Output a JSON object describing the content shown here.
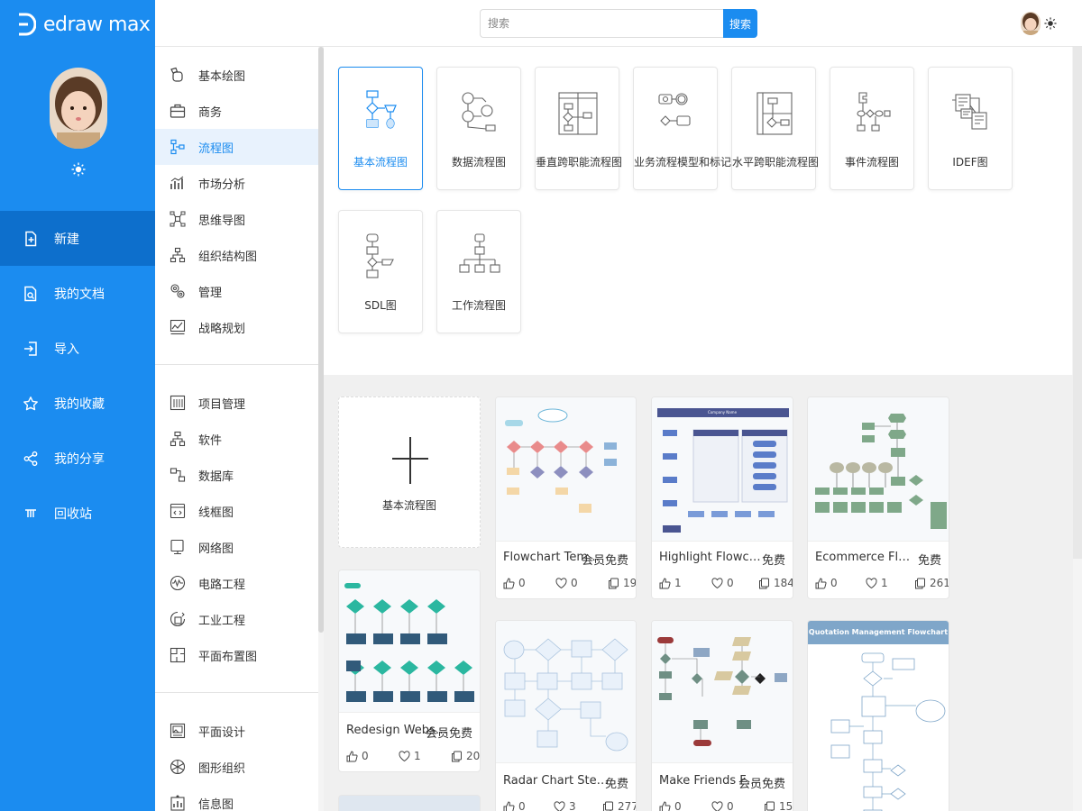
{
  "app": {
    "brand": "edraw max"
  },
  "search": {
    "placeholder": "搜索",
    "button": "搜索"
  },
  "leftnav": [
    {
      "label": "新建",
      "icon": "new-file-icon",
      "active": true
    },
    {
      "label": "我的文档",
      "icon": "documents-icon"
    },
    {
      "label": "导入",
      "icon": "import-icon"
    },
    {
      "label": "我的收藏",
      "icon": "star-icon"
    },
    {
      "label": "我的分享",
      "icon": "share-icon"
    },
    {
      "label": "回收站",
      "icon": "trash-icon"
    }
  ],
  "categories": {
    "group1": [
      {
        "label": "基本绘图",
        "icon": "basic-shapes-icon"
      },
      {
        "label": "商务",
        "icon": "briefcase-icon"
      },
      {
        "label": "流程图",
        "icon": "flowchart-icon",
        "active": true
      },
      {
        "label": "市场分析",
        "icon": "bar-chart-icon"
      },
      {
        "label": "思维导图",
        "icon": "mindmap-icon"
      },
      {
        "label": "组织结构图",
        "icon": "org-chart-icon"
      },
      {
        "label": "管理",
        "icon": "management-icon"
      },
      {
        "label": "战略规划",
        "icon": "strategy-chart-icon"
      }
    ],
    "group2": [
      {
        "label": "项目管理",
        "icon": "project-icon"
      },
      {
        "label": "软件",
        "icon": "software-icon"
      },
      {
        "label": "数据库",
        "icon": "database-icon"
      },
      {
        "label": "线框图",
        "icon": "wireframe-icon"
      },
      {
        "label": "网络图",
        "icon": "network-icon"
      },
      {
        "label": "电路工程",
        "icon": "circuit-icon"
      },
      {
        "label": "工业工程",
        "icon": "industrial-icon"
      },
      {
        "label": "平面布置图",
        "icon": "floorplan-icon"
      }
    ],
    "group3": [
      {
        "label": "平面设计",
        "icon": "graphic-design-icon"
      },
      {
        "label": "图形组织",
        "icon": "graphic-organizer-icon"
      },
      {
        "label": "信息图",
        "icon": "infographic-icon"
      }
    ]
  },
  "types": [
    {
      "label": "基本流程图",
      "active": true
    },
    {
      "label": "数据流程图"
    },
    {
      "label": "垂直跨职能流程图"
    },
    {
      "label": "业务流程模型和标记法"
    },
    {
      "label": "水平跨职能流程图"
    },
    {
      "label": "事件流程图"
    },
    {
      "label": "IDEF图"
    },
    {
      "label": "SDL图"
    },
    {
      "label": "工作流程图"
    }
  ],
  "new_card": {
    "label": "基本流程图"
  },
  "templates": [
    {
      "name": "Flowchart Templ...",
      "price": "会员免费",
      "likes": "0",
      "favorites": "0",
      "copies": "19"
    },
    {
      "name": "Highlight Flowchart",
      "price": "免费",
      "likes": "1",
      "favorites": "0",
      "copies": "184",
      "thumb_title": "Company Name"
    },
    {
      "name": "Ecommerce Flowchar...",
      "price": "免费",
      "likes": "0",
      "favorites": "1",
      "copies": "261"
    },
    {
      "name": "Redesign Websit...",
      "price": "会员免费",
      "likes": "0",
      "favorites": "1",
      "copies": "20"
    },
    {
      "name": "Radar Chart Steps",
      "price": "免费",
      "likes": "0",
      "favorites": "3",
      "copies": "277"
    },
    {
      "name": "Make Friends Flo...",
      "price": "会员免费",
      "likes": "0",
      "favorites": "0",
      "copies": "15"
    },
    {
      "name": "",
      "price": "",
      "thumb_title": "Quotation Management Flowchart"
    }
  ],
  "colors": {
    "primary": "#1b8cf0",
    "nav_active": "#0d6fcc"
  }
}
